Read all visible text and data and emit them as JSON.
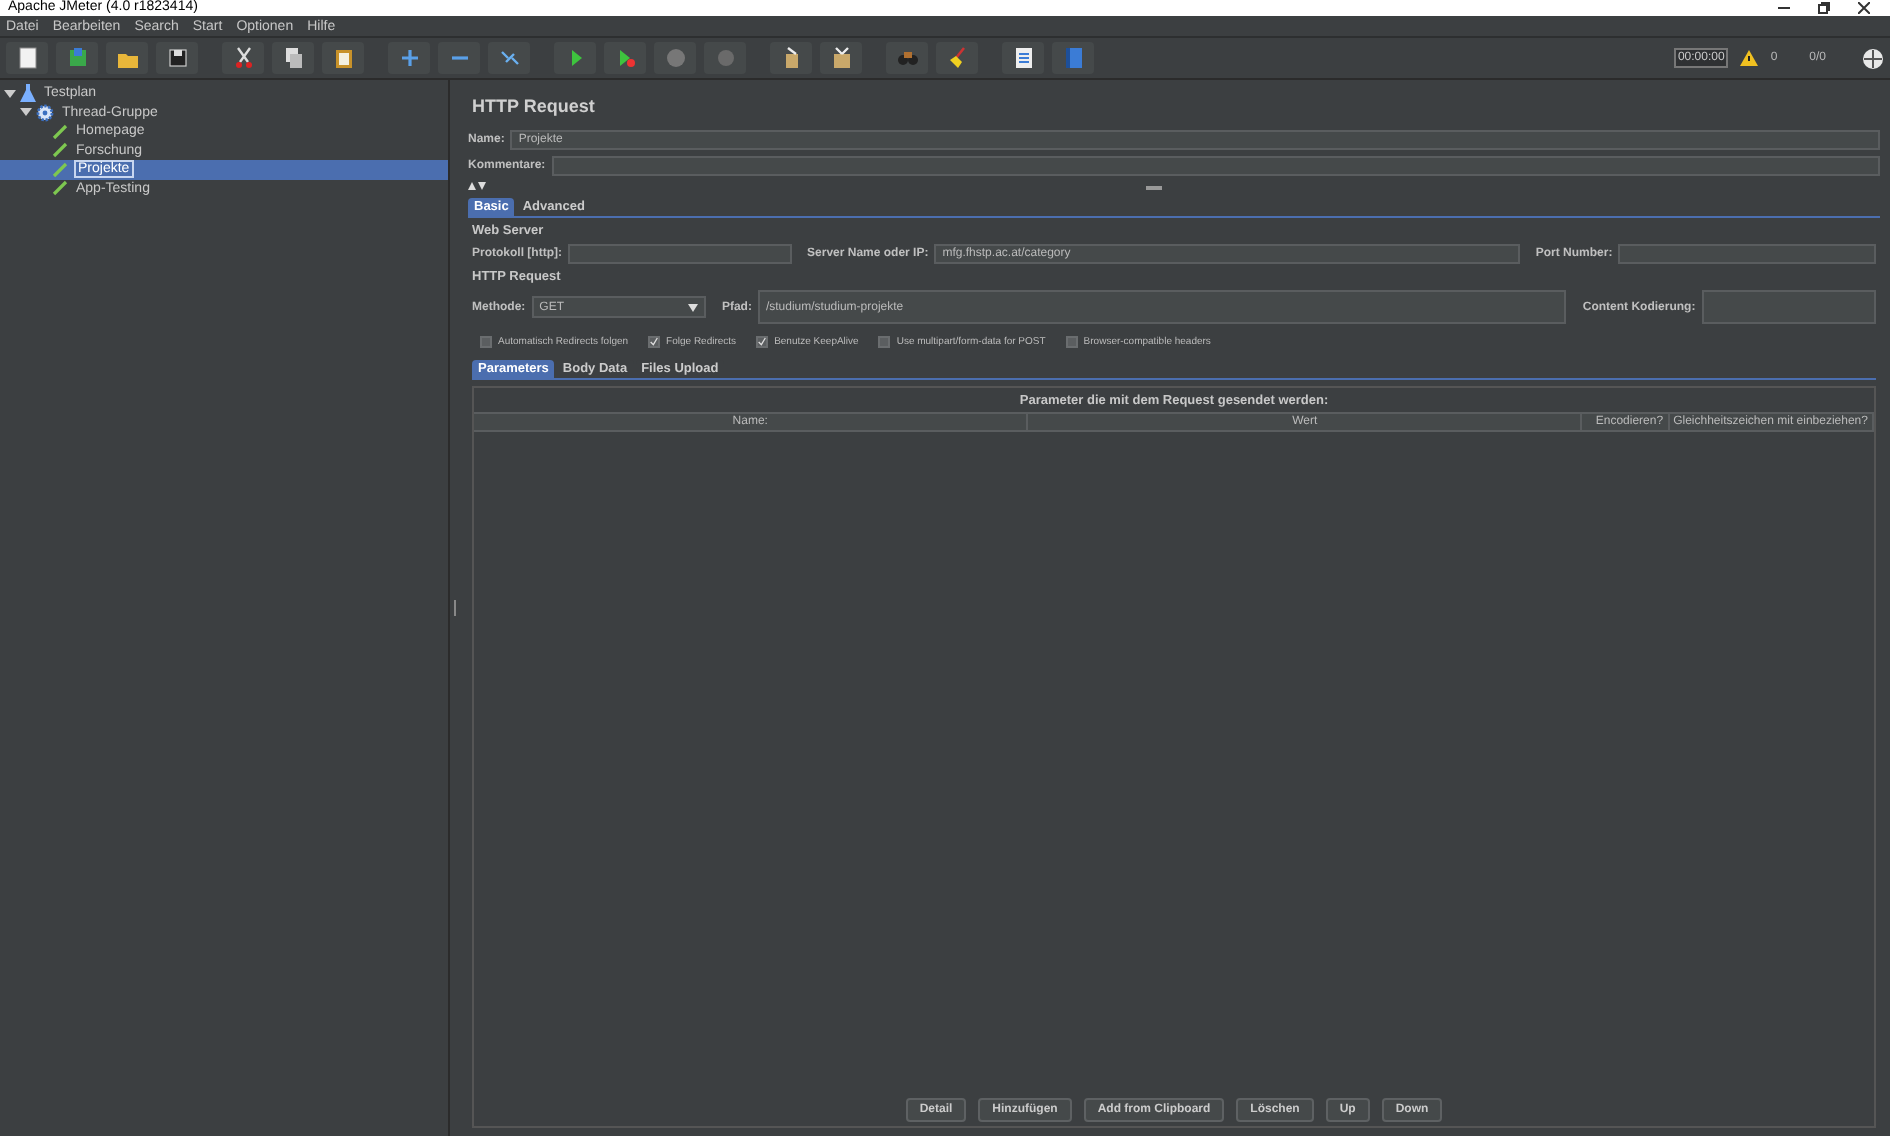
{
  "window": {
    "title": "Apache JMeter (4.0 r1823414)"
  },
  "menu": [
    "Datei",
    "Bearbeiten",
    "Search",
    "Start",
    "Optionen",
    "Hilfe"
  ],
  "status": {
    "timer": "00:00:00",
    "warnings": "0",
    "threads": "0/0"
  },
  "tree": [
    {
      "label": "Testplan",
      "kind": "plan",
      "expanded": true,
      "selected": false,
      "children": [
        {
          "label": "Thread-Gruppe",
          "kind": "group",
          "expanded": true,
          "selected": false,
          "children": [
            {
              "label": "Homepage",
              "kind": "sampler",
              "selected": false
            },
            {
              "label": "Forschung",
              "kind": "sampler",
              "selected": false
            },
            {
              "label": "Projekte",
              "kind": "sampler",
              "selected": true
            },
            {
              "label": "App-Testing",
              "kind": "sampler",
              "selected": false
            }
          ]
        }
      ]
    }
  ],
  "panel": {
    "title": "HTTP Request",
    "name_label": "Name:",
    "name_value": "Projekte",
    "comment_label": "Kommentare:",
    "tabs": [
      {
        "label": "Basic",
        "selected": true
      },
      {
        "label": "Advanced",
        "selected": false
      }
    ],
    "web_server": {
      "title": "Web Server",
      "protocol_label": "Protokoll [http]:",
      "server_label": "Server Name oder IP:",
      "server_value": "mfg.fhstp.ac.at/category",
      "port_label": "Port Number:"
    },
    "http_request": {
      "title": "HTTP Request",
      "method_label": "Methode:",
      "method_value": "GET",
      "path_label": "Pfad:",
      "path_value": "/studium/studium-projekte",
      "encoding_label": "Content Kodierung:"
    },
    "options": [
      {
        "label": "Automatisch Redirects folgen",
        "checked": false
      },
      {
        "label": "Folge Redirects",
        "checked": true
      },
      {
        "label": "Benutze KeepAlive",
        "checked": true
      },
      {
        "label": "Use multipart/form-data for POST",
        "checked": false
      },
      {
        "label": "Browser-compatible headers",
        "checked": false
      }
    ],
    "sub_tabs": [
      {
        "label": "Parameters",
        "selected": true
      },
      {
        "label": "Body Data",
        "selected": false
      },
      {
        "label": "Files Upload",
        "selected": false
      }
    ],
    "table": {
      "caption": "Parameter die mit dem Request gesendet werden:",
      "columns": [
        "Name:",
        "Wert",
        "Encodieren?",
        "Gleichheitszeichen mit einbeziehen?"
      ]
    },
    "buttons": [
      "Detail",
      "Hinzufügen",
      "Add from Clipboard",
      "Löschen",
      "Up",
      "Down"
    ]
  }
}
